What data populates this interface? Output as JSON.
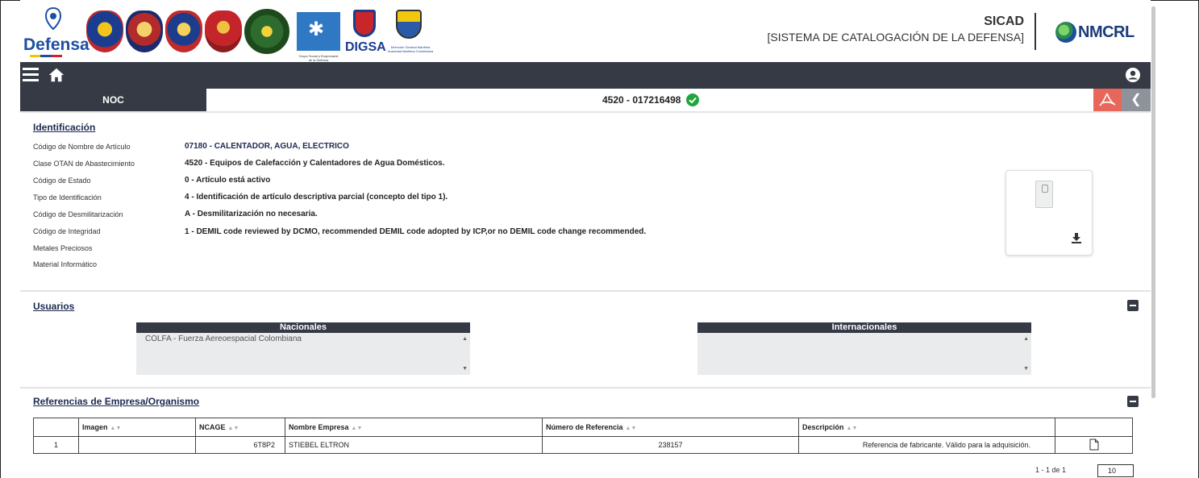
{
  "header": {
    "logo_text": "Defensa",
    "logo_digsa": "DIGSA",
    "logo_grupo": "Grupo Social y Empresarial de la Defensa",
    "logo_dimar": "Dirección General Marítima Autoridad Marítima Colombiana",
    "app_name": "SICAD",
    "app_subtitle": "[SISTEMA DE CATALOGACIÓN DE LA DEFENSA]",
    "partner": "NMCRL"
  },
  "nocbar": {
    "noc_label": "NOC",
    "noc_value": "4520 - 017216498"
  },
  "identificacion": {
    "title": "Identificación",
    "rows": [
      {
        "label": "Código de Nombre de Artículo",
        "value": "07180 - CALENTADOR, AGUA, ELECTRICO"
      },
      {
        "label": "Clase OTAN de Abastecimiento",
        "value": "4520 - Equipos de Calefacción y Calentadores de Agua Domésticos."
      },
      {
        "label": "Código de Estado",
        "value": "0 - Artículo está activo"
      },
      {
        "label": "Tipo de Identificación",
        "value": "4 - Identificación de artículo descriptiva parcial (concepto del tipo 1)."
      },
      {
        "label": "Código de Desmilitarización",
        "value": "A - Desmilitarización no necesaria."
      },
      {
        "label": "Código de Integridad",
        "value": "1 - DEMIL code reviewed by DCMO, recommended DEMIL code adopted by ICP,or no DEMIL code change recommended."
      },
      {
        "label": "Metales Preciosos",
        "value": ""
      },
      {
        "label": "Material Informático",
        "value": ""
      }
    ]
  },
  "usuarios": {
    "title": "Usuarios",
    "nacionales_header": "Nacionales",
    "nacionales_items": [
      "COLFA - Fuerza Aereoespacial Colombiana"
    ],
    "internacionales_header": "Internacionales"
  },
  "referencias": {
    "title": "Referencias de Empresa/Organismo",
    "columns": [
      "",
      "Imagen",
      "NCAGE",
      "Nombre Empresa",
      "Número de Referencia",
      "Descripción",
      ""
    ],
    "rows": [
      {
        "idx": "1",
        "imagen": "",
        "ncage": "6T8P2",
        "empresa": "STIEBEL ELTRON",
        "referencia": "238157",
        "descripcion": "Referencia de fabricante. Válido para la adquisición."
      }
    ],
    "pager_text": "1 - 1 de 1",
    "page_size": "10"
  },
  "colors": {
    "dark_bar": "#363a45",
    "pdf_button": "#e9675a",
    "check": "#1fa53c",
    "link": "#1d2a4f"
  }
}
